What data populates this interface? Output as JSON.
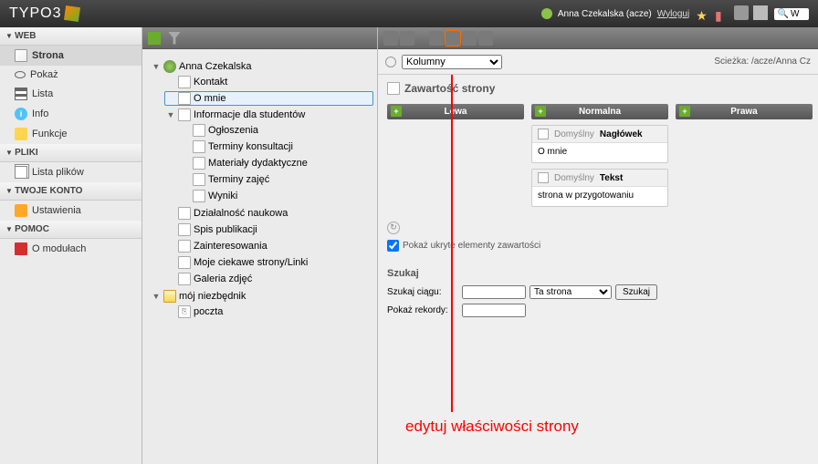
{
  "brand": "TYPO3",
  "user": {
    "name": "Anna Czekalska (acze)",
    "logout": "Wyloguj"
  },
  "sidebar": {
    "sections": [
      {
        "title": "WEB",
        "items": [
          {
            "label": "Strona",
            "icon": "i-page",
            "active": true
          },
          {
            "label": "Pokaż",
            "icon": "i-eye"
          },
          {
            "label": "Lista",
            "icon": "i-list"
          },
          {
            "label": "Info",
            "icon": "i-info"
          },
          {
            "label": "Funkcje",
            "icon": "i-func"
          }
        ]
      },
      {
        "title": "PLIKI",
        "items": [
          {
            "label": "Lista plików",
            "icon": "i-files"
          }
        ]
      },
      {
        "title": "TWOJE KONTO",
        "items": [
          {
            "label": "Ustawienia",
            "icon": "i-settings"
          }
        ]
      },
      {
        "title": "POMOC",
        "items": [
          {
            "label": "O modułach",
            "icon": "i-book"
          }
        ]
      }
    ]
  },
  "tree": {
    "root": "Anna Czekalska",
    "children": [
      {
        "label": "Kontakt"
      },
      {
        "label": "O mnie",
        "selected": true
      },
      {
        "label": "Informacje dla studentów",
        "expanded": true,
        "children": [
          {
            "label": "Ogłoszenia"
          },
          {
            "label": "Terminy konsultacji"
          },
          {
            "label": "Materiały dydaktyczne"
          },
          {
            "label": "Terminy zajęć"
          },
          {
            "label": "Wyniki"
          }
        ]
      },
      {
        "label": "Działalność naukowa"
      },
      {
        "label": "Spis publikacji"
      },
      {
        "label": "Zainteresowania"
      },
      {
        "label": "Moje ciekawe strony/Linki"
      },
      {
        "label": "Galeria zdjęć"
      }
    ],
    "extra": {
      "label": "mój niezbędnik",
      "children": [
        {
          "label": "poczta",
          "icon": "link-i"
        }
      ]
    }
  },
  "content": {
    "layout_select": "Kolumny",
    "breadcrumb": "Ścieżka: /acze/Anna Cz",
    "page_title": "Zawartość strony",
    "columns": [
      {
        "name": "Lewa",
        "elements": []
      },
      {
        "name": "Normalna",
        "elements": [
          {
            "type": "Domyślny",
            "title": "Nagłówek",
            "body": "O mnie"
          },
          {
            "type": "Domyślny",
            "title": "Tekst",
            "body": "strona w przygotowaniu"
          }
        ]
      },
      {
        "name": "Prawa",
        "elements": []
      }
    ],
    "hidden_toggle": "Pokaż ukryte elementy zawartości",
    "search": {
      "heading": "Szukaj",
      "string_label": "Szukaj ciągu:",
      "scope": "Ta strona",
      "button": "Szukaj",
      "records_label": "Pokaż rekordy:"
    }
  },
  "annotation": "edytuj właściwości strony"
}
